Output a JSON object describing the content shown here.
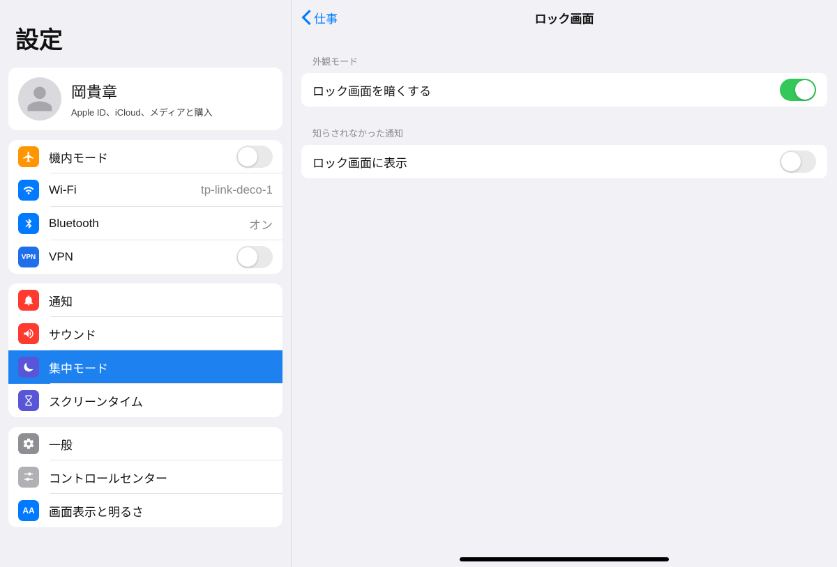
{
  "sidebar": {
    "title": "設定",
    "profile": {
      "name": "岡貴章",
      "subtitle": "Apple ID、iCloud、メディアと購入"
    },
    "group_connectivity": [
      {
        "id": "airplane",
        "label": "機内モード",
        "value": "",
        "control": "switch-off",
        "icon": "airplane",
        "color": "#ff9500"
      },
      {
        "id": "wifi",
        "label": "Wi-Fi",
        "value": "tp-link-deco-1",
        "control": "value",
        "icon": "wifi",
        "color": "#007aff"
      },
      {
        "id": "bluetooth",
        "label": "Bluetooth",
        "value": "オン",
        "control": "value",
        "icon": "bluetooth",
        "color": "#007aff"
      },
      {
        "id": "vpn",
        "label": "VPN",
        "value": "",
        "control": "switch-off",
        "icon": "vpn",
        "color": "#1f6feb"
      }
    ],
    "group_notifications": [
      {
        "id": "notifications",
        "label": "通知",
        "icon": "bell",
        "color": "#ff3b30",
        "selected": false
      },
      {
        "id": "sound",
        "label": "サウンド",
        "icon": "speaker",
        "color": "#ff3b30",
        "selected": false
      },
      {
        "id": "focus",
        "label": "集中モード",
        "icon": "moon",
        "color": "#5856d6",
        "selected": true
      },
      {
        "id": "screentime",
        "label": "スクリーンタイム",
        "icon": "hourglass",
        "color": "#5856d6",
        "selected": false
      }
    ],
    "group_general": [
      {
        "id": "general",
        "label": "一般",
        "icon": "gear",
        "color": "#8e8e93"
      },
      {
        "id": "controlcenter",
        "label": "コントロールセンター",
        "icon": "switches",
        "color": "#b0b0b5"
      },
      {
        "id": "display",
        "label": "画面表示と明るさ",
        "icon": "aa",
        "color": "#007aff"
      }
    ]
  },
  "detail": {
    "back_label": "仕事",
    "title": "ロック画面",
    "section1_header": "外観モード",
    "row1_label": "ロック画面を暗くする",
    "row1_on": true,
    "section2_header": "知らされなかった通知",
    "row2_label": "ロック画面に表示",
    "row2_on": false
  }
}
